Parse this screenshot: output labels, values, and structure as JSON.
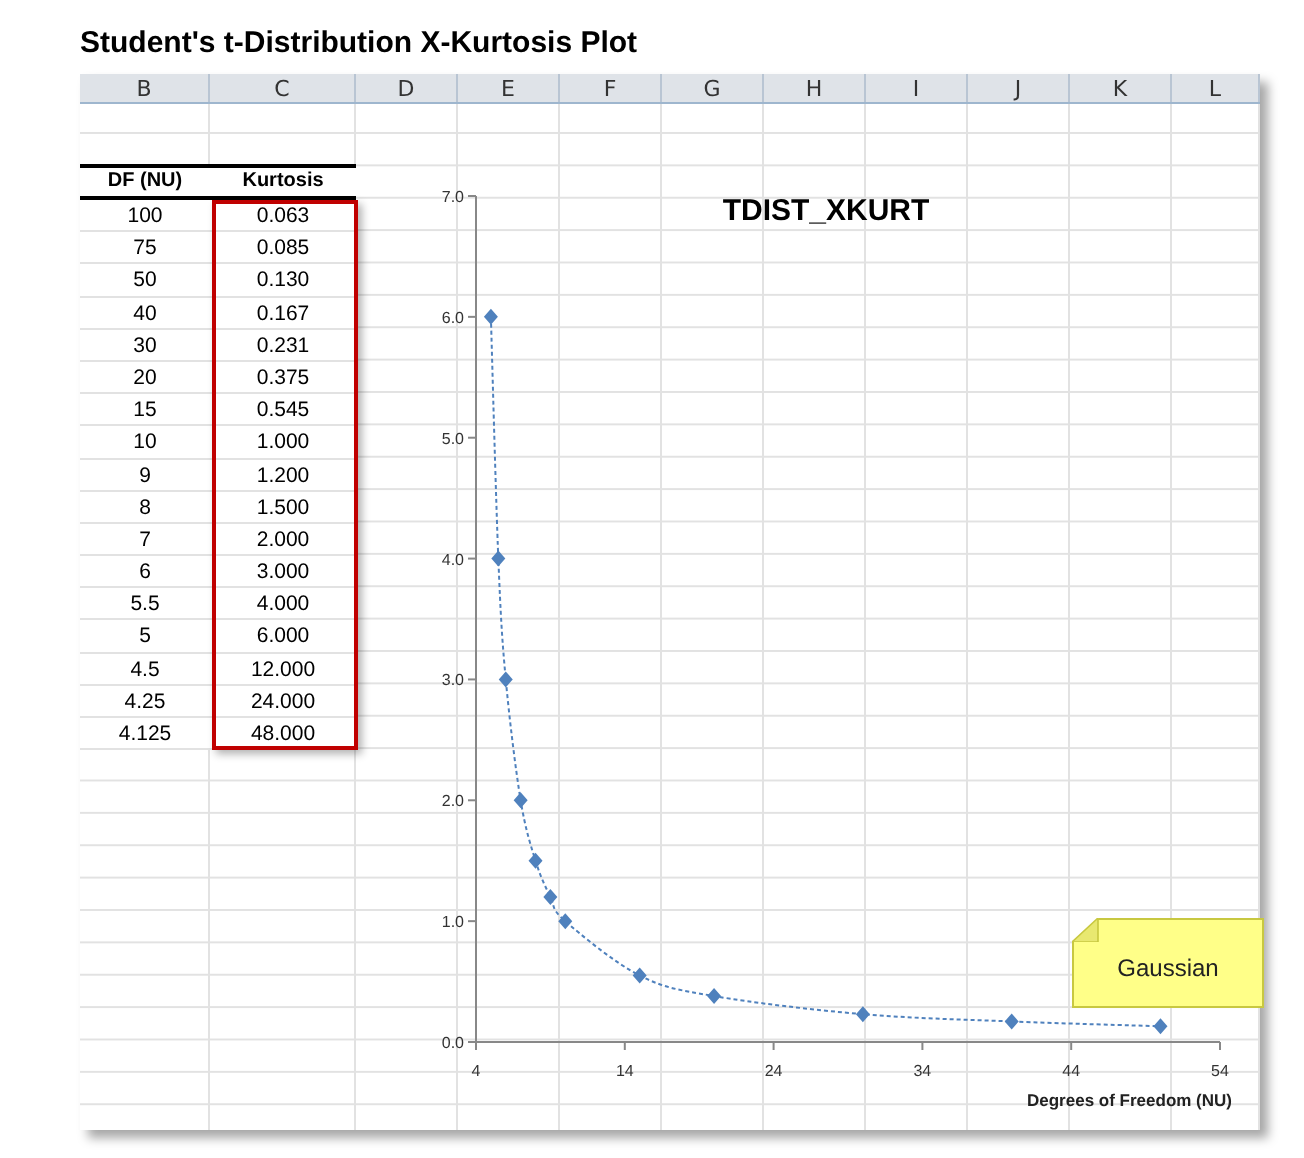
{
  "title": "Student's t-Distribution X-Kurtosis Plot",
  "column_headers": [
    "B",
    "C",
    "D",
    "E",
    "F",
    "G",
    "H",
    "I",
    "J",
    "K",
    "L"
  ],
  "table": {
    "columns": [
      "DF (NU)",
      "Kurtosis"
    ],
    "rows": [
      [
        "100",
        "0.063"
      ],
      [
        "75",
        "0.085"
      ],
      [
        "50",
        "0.130"
      ],
      [
        "40",
        "0.167"
      ],
      [
        "30",
        "0.231"
      ],
      [
        "20",
        "0.375"
      ],
      [
        "15",
        "0.545"
      ],
      [
        "10",
        "1.000"
      ],
      [
        "9",
        "1.200"
      ],
      [
        "8",
        "1.500"
      ],
      [
        "7",
        "2.000"
      ],
      [
        "6",
        "3.000"
      ],
      [
        "5.5",
        "4.000"
      ],
      [
        "5",
        "6.000"
      ],
      [
        "4.5",
        "12.000"
      ],
      [
        "4.25",
        "24.000"
      ],
      [
        "4.125",
        "48.000"
      ]
    ]
  },
  "chart_data": {
    "type": "line",
    "title": "TDIST_XKURT",
    "xlabel": "Degrees of Freedom (NU)",
    "x": [
      5,
      5.5,
      6,
      7,
      8,
      9,
      10,
      15,
      20,
      30,
      40,
      50
    ],
    "series": [
      {
        "color": "#4f81bd",
        "line_style": "dashed",
        "marker": "diamond",
        "values": [
          6,
          4,
          3,
          2,
          1.5,
          1.2,
          1,
          0.55,
          0.38,
          0.23,
          0.17,
          0.13
        ]
      }
    ],
    "xlim": [
      4,
      54
    ],
    "ylim": [
      0,
      7
    ],
    "xticks": [
      4,
      14,
      24,
      34,
      44,
      54
    ],
    "yticks": [
      {
        "value": 0,
        "label": "0.0"
      },
      {
        "value": 1,
        "label": "1.0"
      },
      {
        "value": 2,
        "label": "2.0"
      },
      {
        "value": 3,
        "label": "3.0"
      },
      {
        "value": 4,
        "label": "4.0"
      },
      {
        "value": 5,
        "label": "5.0"
      },
      {
        "value": 6,
        "label": "6.0"
      },
      {
        "value": 7,
        "label": "7.0"
      }
    ],
    "annotations": [
      {
        "text": "Gaussian"
      }
    ]
  }
}
